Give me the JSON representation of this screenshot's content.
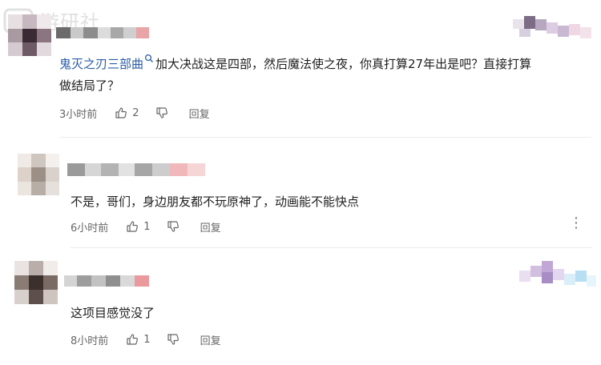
{
  "watermark": {
    "text": "游研社"
  },
  "comment1": {
    "mention": "鬼灭之刃三部曲",
    "text": "加大决战这是四部，然后魔法使之夜，你真打算27年出是吧？直接打算",
    "text_cont": "做结局了？",
    "time": "3小时前",
    "likes": "2",
    "reply_label": "回复"
  },
  "comment2": {
    "text": "不是，哥们，身边朋友都不玩原神了，动画能不能快点",
    "time": "6小时前",
    "likes": "1",
    "reply_label": "回复",
    "more_glyph": "⋮"
  },
  "comment3": {
    "text": "这项目感觉没了",
    "time": "8小时前",
    "likes": "1",
    "reply_label": "回复"
  }
}
